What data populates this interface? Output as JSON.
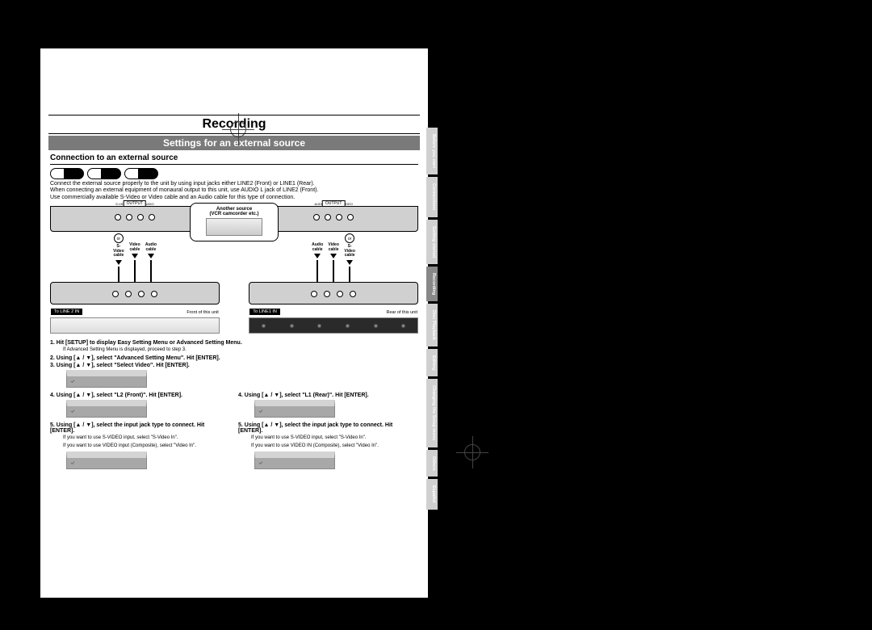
{
  "title": "Recording",
  "subtitle": "Settings for an external source",
  "section_heading": "Connection to an external source",
  "intro": {
    "p1": "Connect the external source properly to the unit by using input jacks either LINE2 (Front) or LINE1 (Rear).",
    "p2": "When connecting an external equipment of monaural output to this unit, use AUDIO L jack of LINE2 (Front).",
    "p3": "Use commercially available S-Video or Video cable and an Audio cable for this type of connection."
  },
  "diagram": {
    "source_label": "Another source\n(VCR camcorder etc.)",
    "output_label": "OUTPUT",
    "jack_labels": [
      "S-VIDEO",
      "VIDEO",
      "AUDIO"
    ],
    "or": "or",
    "left": {
      "cables": [
        "S-Video\ncable",
        "Video\ncable",
        "Audio\ncable"
      ],
      "tag": "To LINE 2 IN",
      "unit": "Front of this unit"
    },
    "right": {
      "cables": [
        "Audio\ncable",
        "Video\ncable",
        "S-Video\ncable"
      ],
      "tag": "To LINE1 IN",
      "unit": "Rear of this unit"
    }
  },
  "steps": {
    "s1": "1. Hit [SETUP] to display Easy Setting Menu or Advanced Setting Menu.",
    "s1_note": "If Advanced Setting Menu is displayed, proceed to step 3.",
    "s2": "2. Using [▲ / ▼], select \"Advanced Setting Menu\". Hit [ENTER].",
    "s3": "3. Using [▲ / ▼], select \"Select Video\". Hit [ENTER].",
    "left": {
      "s4": "4. Using [▲ / ▼], select \"L2 (Front)\". Hit [ENTER].",
      "s5": "5. Using [▲ / ▼], select the input jack type to connect. Hit [ENTER].",
      "s5_p1": "If you want to use S-VIDEO input, select \"S-Video In\".",
      "s5_p2": "If you want to use VIDEO input (Composite), select \"Video In\"."
    },
    "right": {
      "s4": "4. Using [▲ / ▼], select \"L1 (Rear)\". Hit [ENTER].",
      "s5": "5. Using [▲ / ▼], select the input jack type to connect. Hit [ENTER].",
      "s5_p1": "If you want to use S-VIDEO input, select \"S-Video In\".",
      "s5_p2": "If you want to use VIDEO IN (Composite), select \"Video In\"."
    }
  },
  "tabs": [
    "Before you start",
    "Connections",
    "Getting started",
    "Recording",
    "Disc Playback",
    "Editing",
    "Changing the Setup menu",
    "Others",
    "Español"
  ]
}
